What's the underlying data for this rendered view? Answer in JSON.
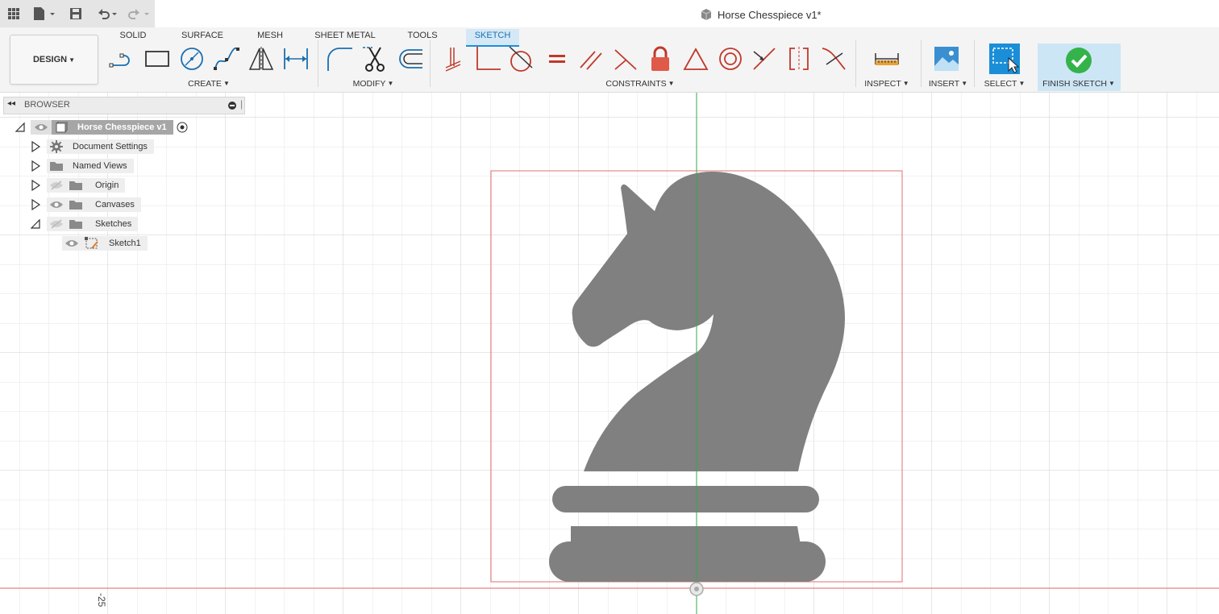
{
  "window": {
    "title": "Horse Chesspiece v1*"
  },
  "ribbon": {
    "workspace_label": "DESIGN",
    "tabs": [
      {
        "label": "SOLID",
        "active": false
      },
      {
        "label": "SURFACE",
        "active": false
      },
      {
        "label": "MESH",
        "active": false
      },
      {
        "label": "SHEET METAL",
        "active": false
      },
      {
        "label": "TOOLS",
        "active": false
      },
      {
        "label": "SKETCH",
        "active": true
      }
    ],
    "groups": {
      "create": "CREATE",
      "modify": "MODIFY",
      "constraints": "CONSTRAINTS",
      "inspect": "INSPECT",
      "insert": "INSERT",
      "select": "SELECT",
      "finish": "FINISH SKETCH"
    }
  },
  "browser": {
    "title": "BROWSER",
    "root": "Horse Chesspiece v1",
    "items": [
      {
        "label": "Document Settings",
        "icon": "gear-icon"
      },
      {
        "label": "Named Views",
        "icon": "folder-icon"
      },
      {
        "label": "Origin",
        "icon": "folder-icon"
      },
      {
        "label": "Canvases",
        "icon": "folder-icon"
      },
      {
        "label": "Sketches",
        "icon": "folder-icon"
      }
    ],
    "sketch": {
      "label": "Sketch1",
      "icon": "sketch-icon"
    }
  },
  "canvas": {
    "ruler_label": "-25",
    "colors": {
      "grid": "#e3e3e3",
      "grid_major": "#cfcfcf",
      "axis_red": "#e05555",
      "axis_green": "#3aa64a",
      "profile": "#808080",
      "accent": "#1a8fd8"
    }
  }
}
